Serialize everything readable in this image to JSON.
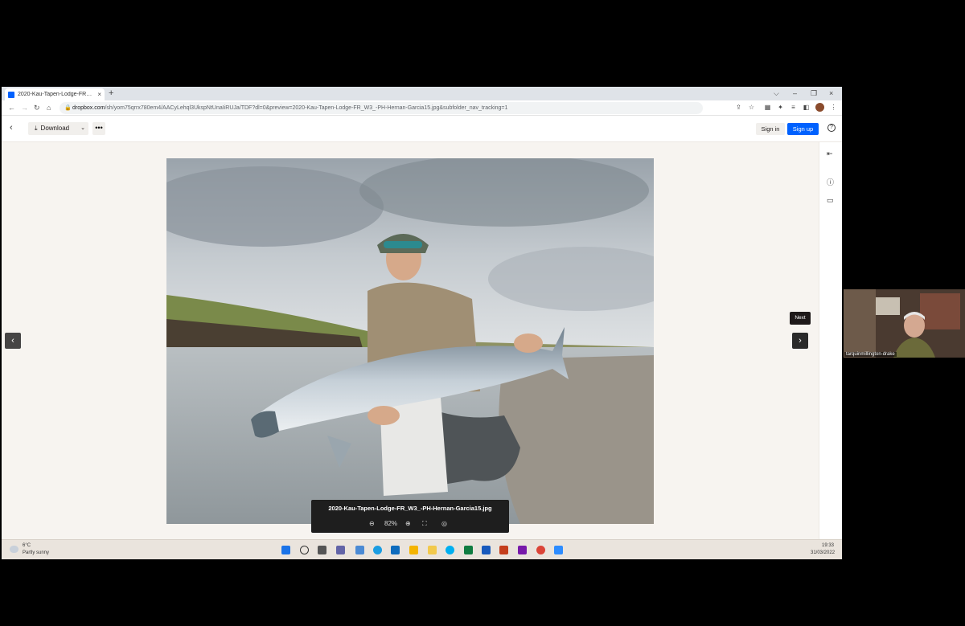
{
  "tab": {
    "title": "2020-Kau-Tapen-Lodge-FR_W3_",
    "close": "×",
    "new_tab": "+"
  },
  "window_controls": {
    "min": "–",
    "restore": "❐",
    "close": "×",
    "chevron": "⌵"
  },
  "address": {
    "domain": "dropbox.com",
    "path": "/sh/yom75qrrx780em4/AACyLehql3UkspNtUnaIiRUJa/TDF?dl=0&preview=2020-Kau-Tapen-Lodge-FR_W3_-PH-Hernan-Garcia15.jpg&subfolder_nav_tracking=1"
  },
  "header": {
    "download_label": "Download",
    "more_label": "•••",
    "signin_label": "Sign in",
    "signup_label": "Sign up",
    "help_label": "?",
    "back_label": "‹"
  },
  "viewer": {
    "next_tooltip": "Next",
    "prev_label": "‹",
    "next_label": "›",
    "filename": "2020-Kau-Tapen-Lodge-FR_W3_-PH-Hernan-Garcia15.jpg",
    "zoom": "82%"
  },
  "taskbar": {
    "temperature": "6°C",
    "weather": "Partly sunny",
    "time": "19:33",
    "date": "31/03/2022"
  },
  "video": {
    "participant_name": "tarquinmillington-drake"
  },
  "colors": {
    "accent": "#0061fe",
    "canvas": "#f7f4f0",
    "caption_bg": "#1e1e1e"
  }
}
